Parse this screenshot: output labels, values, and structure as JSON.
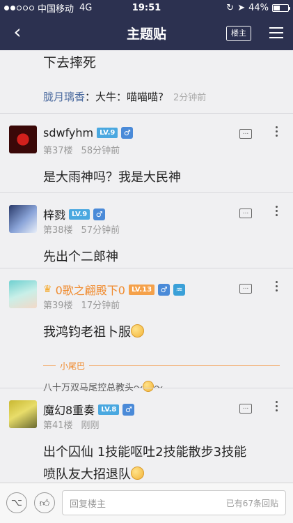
{
  "status_bar": {
    "carrier": "中国移动",
    "network": "4G",
    "time": "19:51",
    "battery": "44%",
    "battery_level": 0.44
  },
  "nav": {
    "title": "主题贴",
    "owner_label": "楼主"
  },
  "previous_post": {
    "text": "下去摔死",
    "sub_reply": {
      "author": "胧月璃香",
      "text": "：大牛：喵喵喵?",
      "time": "2分钟前"
    }
  },
  "floors": [
    {
      "username": "sdwfyhm",
      "level": "LV.9",
      "floor": "第37楼",
      "time": "58分钟前",
      "text": "是大雨神吗？我是大民神"
    },
    {
      "username": "梓戮",
      "level": "LV.9",
      "floor": "第38楼",
      "time": "57分钟前",
      "text": "先出个二郎神"
    },
    {
      "username": "0歌之翩殿下0",
      "level": "LV.13",
      "floor": "第39楼",
      "time": "17分钟前",
      "text": "我鸿钧老祖卜服",
      "tail_label": "小尾巴",
      "tail_text": "八十万双马尾控总教头～",
      "tail_suffix": "～"
    },
    {
      "username": "魔幻8重奏",
      "level": "LV.8",
      "floor": "第41楼",
      "time": "刚刚",
      "text_line1": "出个囚仙 1技能呕吐2技能散步3技能",
      "text_line2": "喷队友大招退队"
    }
  ],
  "bottom_bar": {
    "placeholder": "回复楼主",
    "reply_count": "已有67条回贴"
  }
}
